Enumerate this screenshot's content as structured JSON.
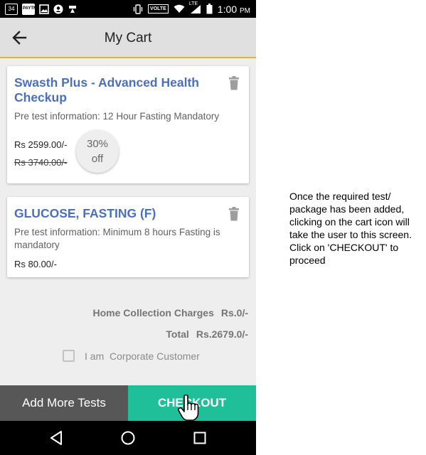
{
  "status_bar": {
    "left_badges": [
      "34",
      "PAYTM"
    ],
    "network_label": "VOLTE",
    "lte_label": "LTE",
    "time": "1:00",
    "time_suffix": "PM",
    "icons": [
      "notification-34-icon",
      "paytm-icon",
      "image-icon",
      "account-icon",
      "send-icon",
      "vibrate-icon",
      "volte-icon",
      "wifi-icon",
      "signal-icon",
      "battery-icon"
    ]
  },
  "app_bar": {
    "title": "My Cart",
    "back_icon": "arrow-back-icon",
    "accent_color": "#e6b422"
  },
  "cart_items": [
    {
      "name": "Swasth Plus - Advanced Health Checkup",
      "pretest": "Pre test information: 12 Hour Fasting Mandatory",
      "price": "Rs 2599.00/-",
      "old_price": "Rs 3740.00/-",
      "discount_line1": "30%",
      "discount_line2": "off"
    },
    {
      "name": "GLUCOSE, FASTING (F)",
      "pretest": "Pre test information: Minimum 8 hours Fasting is mandatory",
      "price": "Rs 80.00/-"
    }
  ],
  "summary": {
    "home_collection_label": "Home Collection Charges",
    "home_collection_value": "Rs.0/-",
    "total_label": "Total",
    "total_value": "Rs.2679.0/-",
    "corporate_label": "I am  Corporate Customer",
    "corporate_checked": false
  },
  "buttons": {
    "add_more": "Add More Tests",
    "checkout": "CHECKOUT",
    "add_color": "#575757",
    "checkout_color": "#1fbf9a"
  },
  "annotation": "Once the required test/ package has been added, clicking on the cart icon will take the user to this screen. Click on 'CHECKOUT' to proceed"
}
